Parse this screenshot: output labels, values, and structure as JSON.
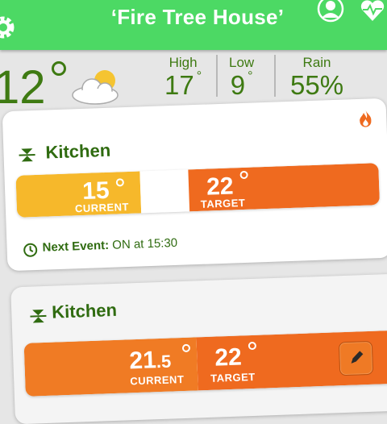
{
  "header": {
    "title": "‘Fire Tree House’",
    "icons": [
      "gear-icon",
      "avatar-icon",
      "heart-pulse-icon"
    ],
    "color": "#4cd964"
  },
  "weather": {
    "current": "12",
    "icon": "cloud-sun-icon",
    "high_label": "High",
    "high_value": "17",
    "low_label": "Low",
    "low_value": "9",
    "rain_label": "Rain",
    "rain_value": "55%"
  },
  "zones": [
    {
      "name": "Kitchen",
      "current": "15",
      "current_label": "CURRENT",
      "target": "22",
      "target_label": "TARGET",
      "next_event_label": "Next Event:",
      "next_event_value": "ON at 15:30",
      "heating": true
    },
    {
      "name": "Kitchen",
      "current_whole": "21",
      "current_frac": ".5",
      "current_label": "CURRENT",
      "target": "22",
      "target_label": "TARGET"
    }
  ],
  "colors": {
    "accent_green": "#3e7a12",
    "current_yellow": "#f6b82b",
    "target_orange": "#ef6a1f"
  }
}
